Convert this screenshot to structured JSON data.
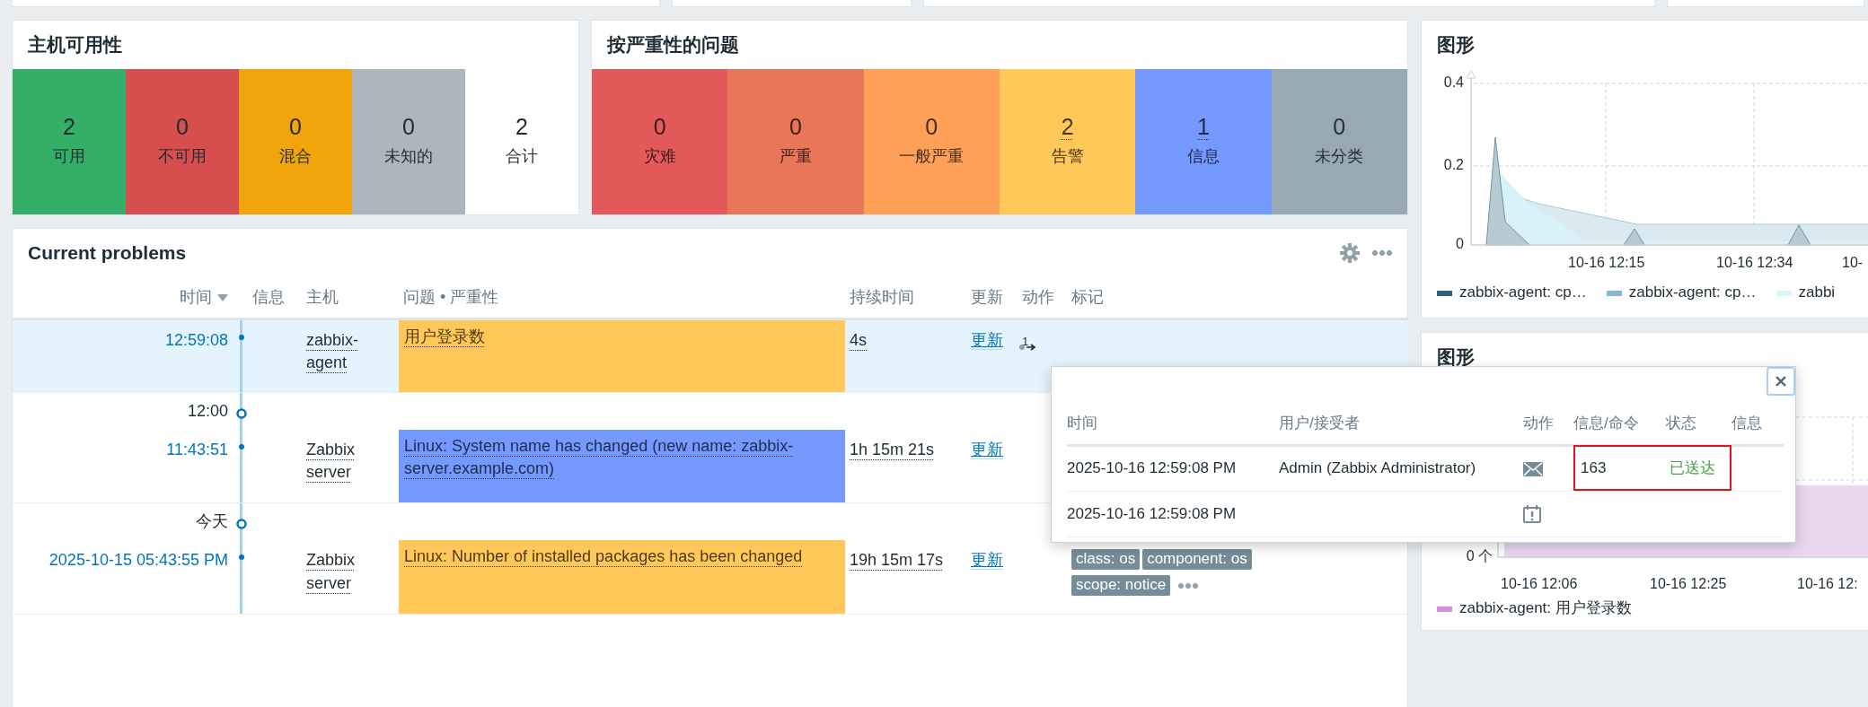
{
  "host_availability": {
    "title": "主机可用性",
    "tiles": [
      {
        "count": "2",
        "label": "可用",
        "color": "#34af67"
      },
      {
        "count": "0",
        "label": "不可用",
        "color": "#d64e4e"
      },
      {
        "count": "0",
        "label": "混合",
        "color": "#f2a40b"
      },
      {
        "count": "0",
        "label": "未知的",
        "color": "#acb7bd"
      },
      {
        "count": "2",
        "label": "合计",
        "color": "#ffffff"
      }
    ]
  },
  "problems_by_severity": {
    "title": "按严重性的问题",
    "tiles": [
      {
        "count": "0",
        "label": "灾难",
        "color": "#e45959",
        "linked": false
      },
      {
        "count": "0",
        "label": "严重",
        "color": "#e97659",
        "linked": false
      },
      {
        "count": "0",
        "label": "一般严重",
        "color": "#ffa059",
        "linked": false
      },
      {
        "count": "2",
        "label": "告警",
        "color": "#ffc859",
        "linked": true
      },
      {
        "count": "1",
        "label": "信息",
        "color": "#7499ff",
        "linked": true
      },
      {
        "count": "0",
        "label": "未分类",
        "color": "#97aab3",
        "linked": false
      }
    ]
  },
  "current_problems": {
    "title": "Current problems",
    "columns": [
      {
        "label": "时间",
        "sorted": true
      },
      {
        "label": "信息",
        "sorted": false
      },
      {
        "label": "主机",
        "sorted": false
      },
      {
        "label": "问题 • 严重性",
        "sorted": false
      },
      {
        "label": "持续时间",
        "sorted": false
      },
      {
        "label": "更新",
        "sorted": false
      },
      {
        "label": "动作",
        "sorted": false
      },
      {
        "label": "标记",
        "sorted": false
      }
    ],
    "rows": [
      {
        "kind": "problem",
        "selected": true,
        "time": "12:59:08",
        "host": "zabbix-agent",
        "problem": "用户登录数",
        "color": "#ffc859",
        "duration": "4s",
        "update": "更新",
        "actions_count": "1",
        "tags": [],
        "has_more_tags": false
      },
      {
        "kind": "separator",
        "label": "12:00"
      },
      {
        "kind": "problem",
        "selected": false,
        "time": "11:43:51",
        "host": "Zabbix server",
        "problem": "Linux: System name has changed (new name: zabbix-server.example.com)",
        "color": "#7499ff",
        "duration": "1h 15m 21s",
        "update": "更新",
        "tags": [],
        "has_more_tags": false
      },
      {
        "kind": "separator",
        "label": "今天"
      },
      {
        "kind": "problem",
        "selected": false,
        "time": "2025-10-15 05:43:55 PM",
        "host": "Zabbix server",
        "problem": "Linux: Number of installed packages has been changed",
        "color": "#ffc859",
        "duration": "19h 15m 17s",
        "update": "更新",
        "tags": [
          "class: os",
          "component: os",
          "scope: notice"
        ],
        "has_more_tags": true
      }
    ]
  },
  "graph_1": {
    "title": "图形",
    "y_ticks": [
      "0.4",
      "0.2",
      "0"
    ],
    "x_ticks": [
      "10-16 12:15",
      "10-16 12:34",
      "10-"
    ],
    "legend": [
      {
        "label": "zabbix-agent: cp…",
        "color": "#2f5f79"
      },
      {
        "label": "zabbix-agent: cp…",
        "color": "#88b8d0"
      },
      {
        "label": "zabbi",
        "color": "#d9f7fb"
      }
    ]
  },
  "graph_2": {
    "title": "图形",
    "y_ticks": [
      "0 个"
    ],
    "x_ticks": [
      "10-16 12:06",
      "10-16 12:25",
      "10-16 12:"
    ],
    "legend": [
      {
        "label": "zabbix-agent: 用户登录数",
        "color": "#cf92d8"
      }
    ]
  },
  "action_popup": {
    "columns": [
      "时间",
      "用户/接受者",
      "动作",
      "信息/命令",
      "状态",
      "信息"
    ],
    "rows": [
      {
        "time": "2025-10-16 12:59:08 PM",
        "recipient": "Admin (Zabbix Administrator)",
        "kind": "message",
        "message": "163",
        "status": "已送达",
        "highlighted": true
      },
      {
        "time": "2025-10-16 12:59:08 PM",
        "kind": "event",
        "highlighted": false
      }
    ]
  }
}
